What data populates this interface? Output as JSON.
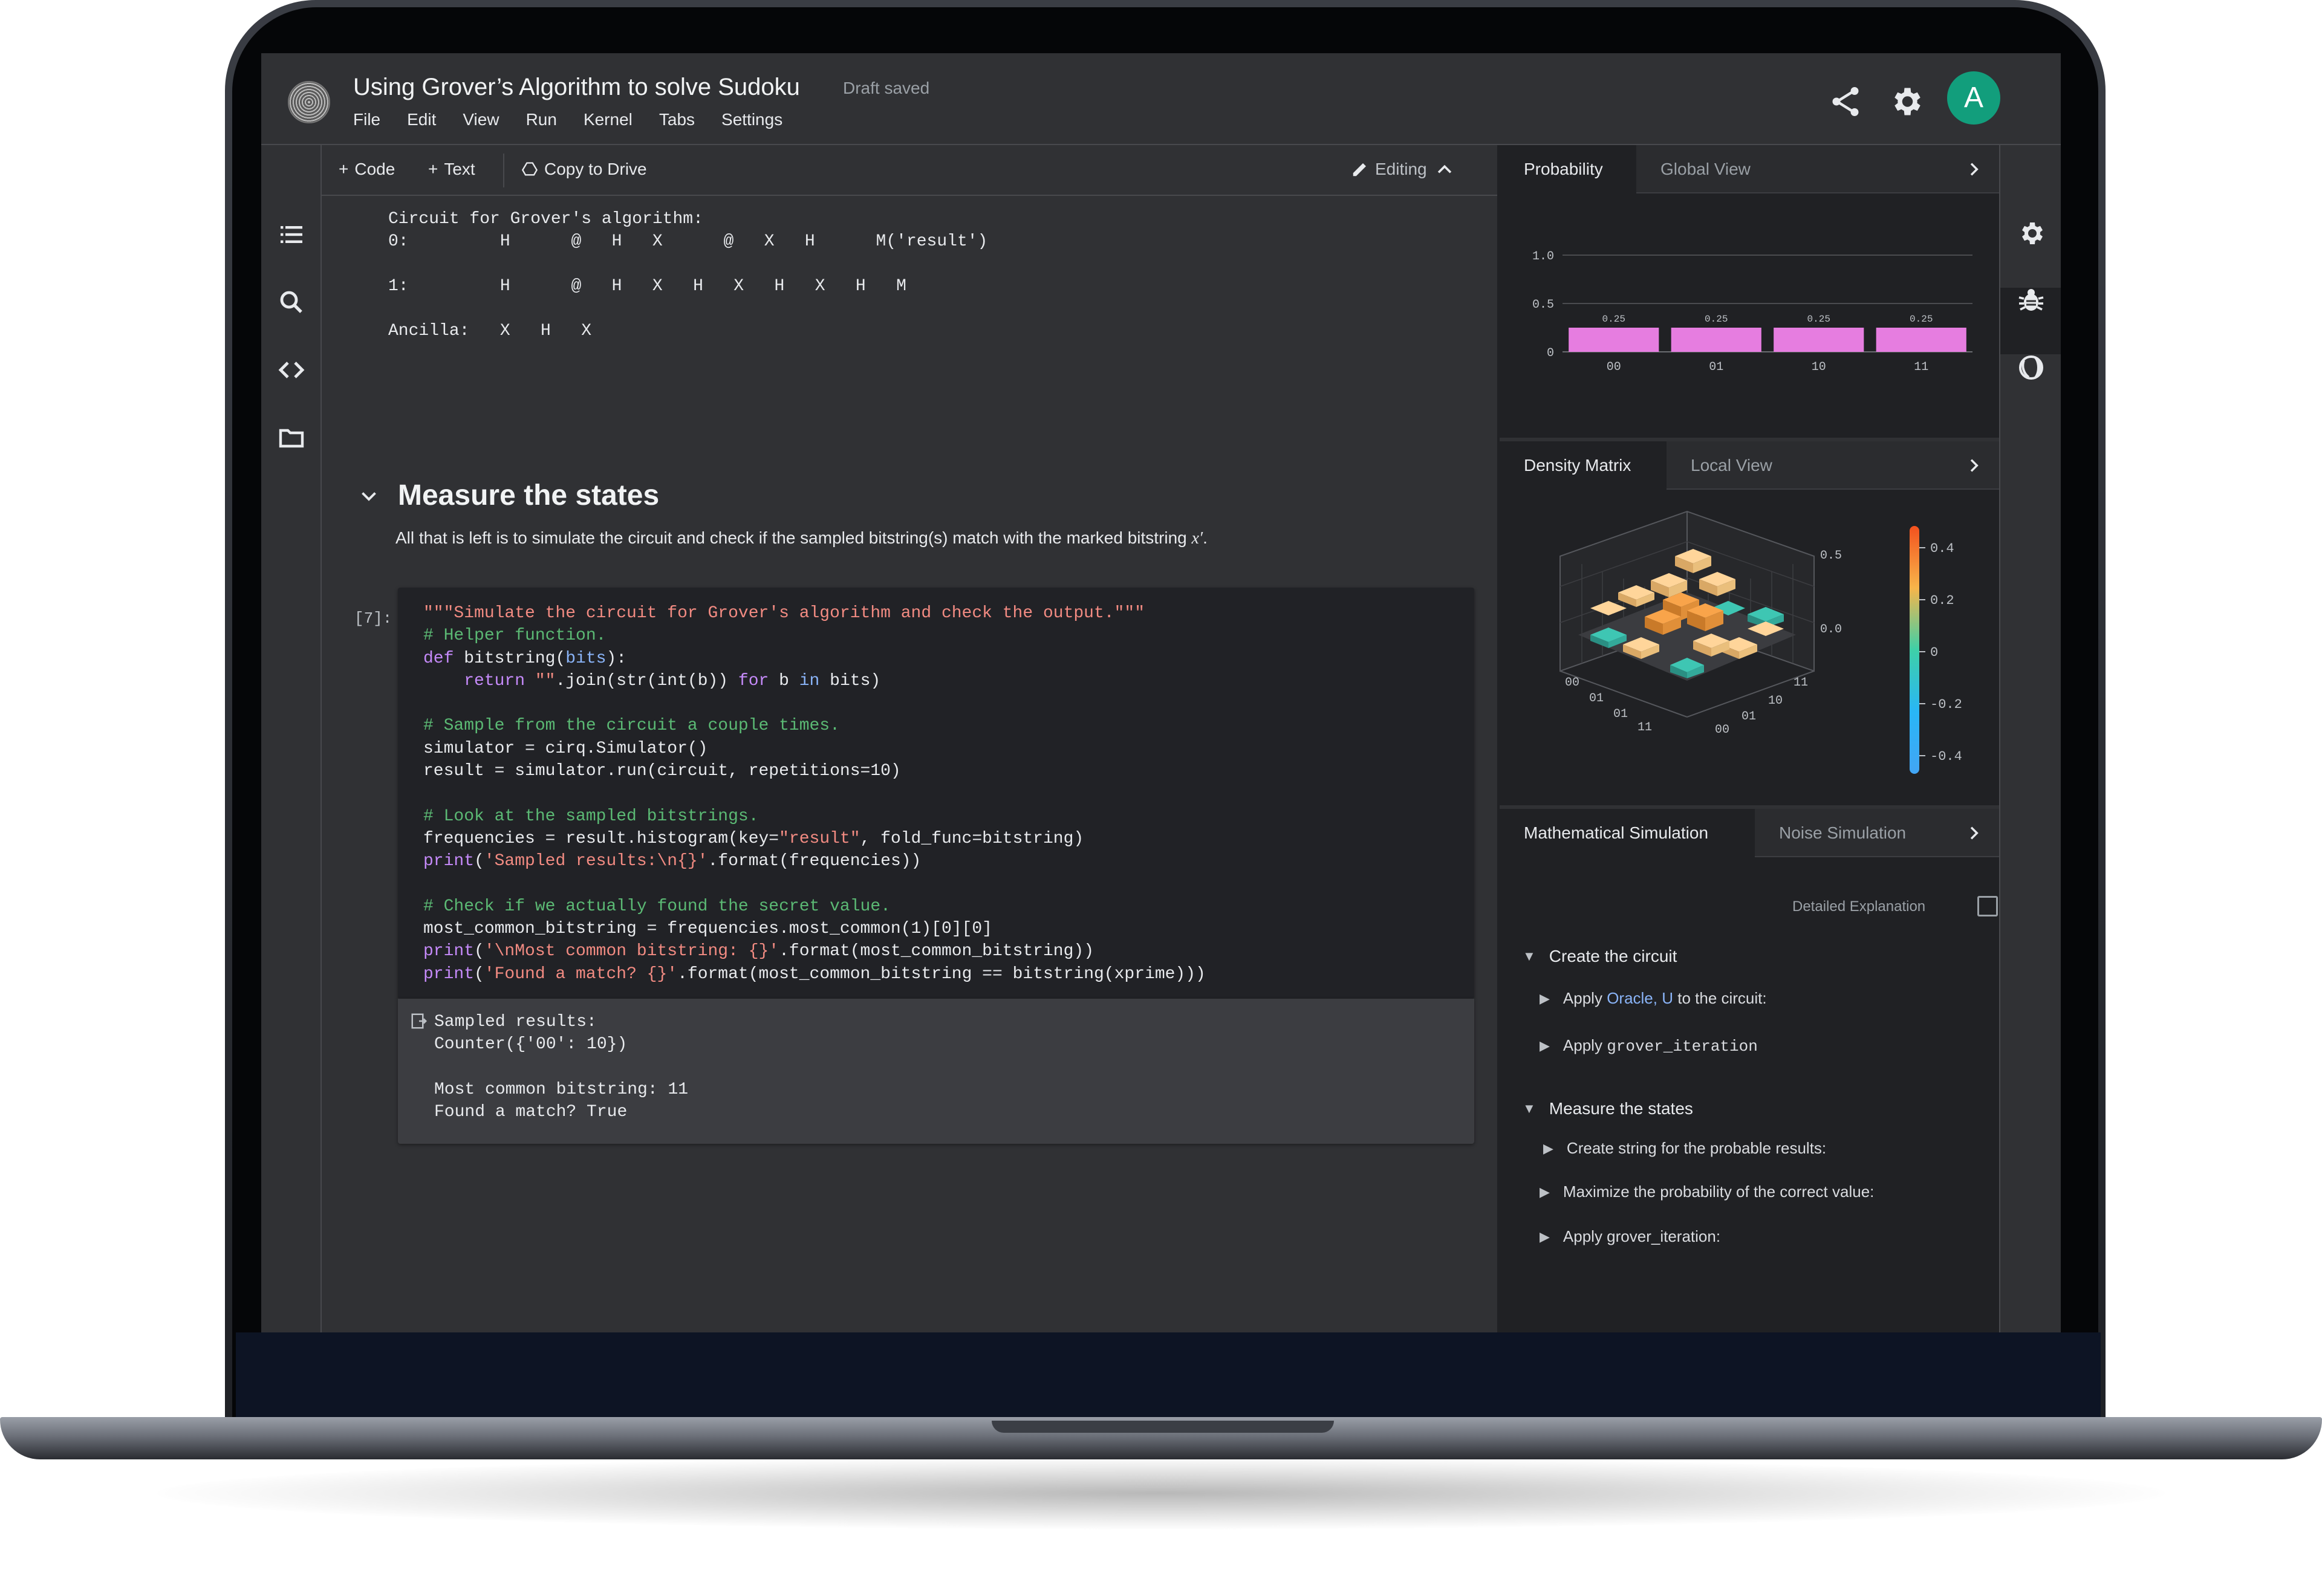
{
  "notebook": {
    "title": "Using Grover’s Algorithm to solve Sudoku",
    "draft_status": "Draft saved",
    "menu": [
      "File",
      "Edit",
      "View",
      "Run",
      "Kernel",
      "Tabs",
      "Settings"
    ],
    "avatar_letter": "A",
    "toolbar": {
      "code_label": "Code",
      "text_label": "Text",
      "copy_label": "Copy to Drive",
      "editing_label": "Editing"
    },
    "circuit_output": "Circuit for Grover's algorithm:\n0:         H      @   H   X      @   X   H      M('result')\n\n1:         H      @   H   X   H   X   H   X   H   M\n\nAncilla:   X   H   X",
    "section_title": "Measure the states",
    "section_desc_prefix": "All that is left is to simulate the circuit and check if the sampled bitstring(s) match with the marked bitstring  ",
    "section_desc_var": "x′",
    "section_desc_suffix": ".",
    "cell_exec_count": "[7]:",
    "cell_output": "Sampled results:\nCounter({'00': 10})\n\nMost common bitstring: 11\nFound a match? True"
  },
  "code_lines": [
    [
      {
        "t": "\"\"\"Simulate the circuit for Grover's algorithm and check the output.\"\"\"",
        "c": "str"
      }
    ],
    [
      {
        "t": "# Helper function.",
        "c": "cm"
      }
    ],
    [
      {
        "t": "def ",
        "c": "kw"
      },
      {
        "t": "bitstring(",
        "c": ""
      },
      {
        "t": "bits",
        "c": "bl"
      },
      {
        "t": "):",
        "c": ""
      }
    ],
    [
      {
        "t": "    ",
        "c": ""
      },
      {
        "t": "return ",
        "c": "kw"
      },
      {
        "t": "\"\"",
        "c": "str"
      },
      {
        "t": ".join(str(int(b)) ",
        "c": ""
      },
      {
        "t": "for ",
        "c": "kw"
      },
      {
        "t": "b ",
        "c": ""
      },
      {
        "t": "in ",
        "c": "bl"
      },
      {
        "t": "bits)",
        "c": ""
      }
    ],
    [
      {
        "t": "",
        "c": ""
      }
    ],
    [
      {
        "t": "# Sample from the circuit a couple times.",
        "c": "cm"
      }
    ],
    [
      {
        "t": "simulator = cirq.Simulator()",
        "c": ""
      }
    ],
    [
      {
        "t": "result = simulator.run(circuit, repetitions=10)",
        "c": ""
      }
    ],
    [
      {
        "t": "",
        "c": ""
      }
    ],
    [
      {
        "t": "# Look at the sampled bitstrings.",
        "c": "cm"
      }
    ],
    [
      {
        "t": "frequencies = result.histogram(key=",
        "c": ""
      },
      {
        "t": "\"result\"",
        "c": "str"
      },
      {
        "t": ", fold_func=bitstring)",
        "c": ""
      }
    ],
    [
      {
        "t": "print",
        "c": "kw"
      },
      {
        "t": "(",
        "c": ""
      },
      {
        "t": "'Sampled results:\\n{}'",
        "c": "str"
      },
      {
        "t": ".format(frequencies))",
        "c": ""
      }
    ],
    [
      {
        "t": "",
        "c": ""
      }
    ],
    [
      {
        "t": "# Check if we actually found the secret value.",
        "c": "cm"
      }
    ],
    [
      {
        "t": "most_common_bitstring = frequencies.most_common(1)[0][0]",
        "c": ""
      }
    ],
    [
      {
        "t": "print",
        "c": "kw"
      },
      {
        "t": "(",
        "c": ""
      },
      {
        "t": "'\\nMost common bitstring: {}'",
        "c": "str"
      },
      {
        "t": ".format(most_common_bitstring))",
        "c": ""
      }
    ],
    [
      {
        "t": "print",
        "c": "kw"
      },
      {
        "t": "(",
        "c": ""
      },
      {
        "t": "'Found a match? {}'",
        "c": "str"
      },
      {
        "t": ".format(most_common_bitstring == bitstring(xprime)))",
        "c": ""
      }
    ]
  ],
  "panels": {
    "probability": {
      "tabs": [
        "Probability",
        "Global View"
      ]
    },
    "density": {
      "tabs": [
        "Density Matrix",
        "Local View"
      ],
      "z_ticks": [
        "0.5",
        "0.0"
      ],
      "left_axis": [
        "00",
        "01",
        "01",
        "11"
      ],
      "right_axis": [
        "00",
        "01",
        "10",
        "11"
      ],
      "colorbar_ticks": [
        "0.4",
        "0.2",
        "0",
        "-0.2",
        "-0.4"
      ]
    },
    "simulation": {
      "tabs": [
        "Mathematical Simulation",
        "Noise Simulation"
      ],
      "detailed_label": "Detailed Explanation",
      "tree": [
        {
          "label": "Create the circuit",
          "level": 0,
          "expanded": true
        },
        {
          "label_prefix": "Apply ",
          "label_hl": "Oracle, U",
          "label_suffix": " to the circuit:",
          "level": 1
        },
        {
          "label_prefix": "Apply ",
          "label_code": "grover_iteration",
          "level": 1
        },
        {
          "label": "Measure the states",
          "level": 0,
          "expanded": true
        },
        {
          "label": "Create string for the probable results:",
          "level": 1
        },
        {
          "label": "Maximize the probability of the correct value:",
          "level": 1
        },
        {
          "label": "Apply grover_iteration:",
          "level": 1
        }
      ]
    }
  },
  "chart_data": {
    "type": "bar",
    "categories": [
      "00",
      "01",
      "10",
      "11"
    ],
    "values": [
      0.25,
      0.25,
      0.25,
      0.25
    ],
    "data_labels": [
      "0.25",
      "0.25",
      "0.25",
      "0.25"
    ],
    "yticks": [
      "1.0",
      "0.5",
      "0"
    ],
    "ylim": [
      0,
      1.0
    ],
    "grid": true,
    "bar_color": "#e67de0"
  },
  "colors": {
    "accent_avatar": "#129e7c",
    "bar": "#e67de0",
    "code_string": "#f28b82",
    "code_comment": "#5bb974",
    "code_keyword": "#c58af9",
    "code_builtin": "#8ab4f8"
  }
}
